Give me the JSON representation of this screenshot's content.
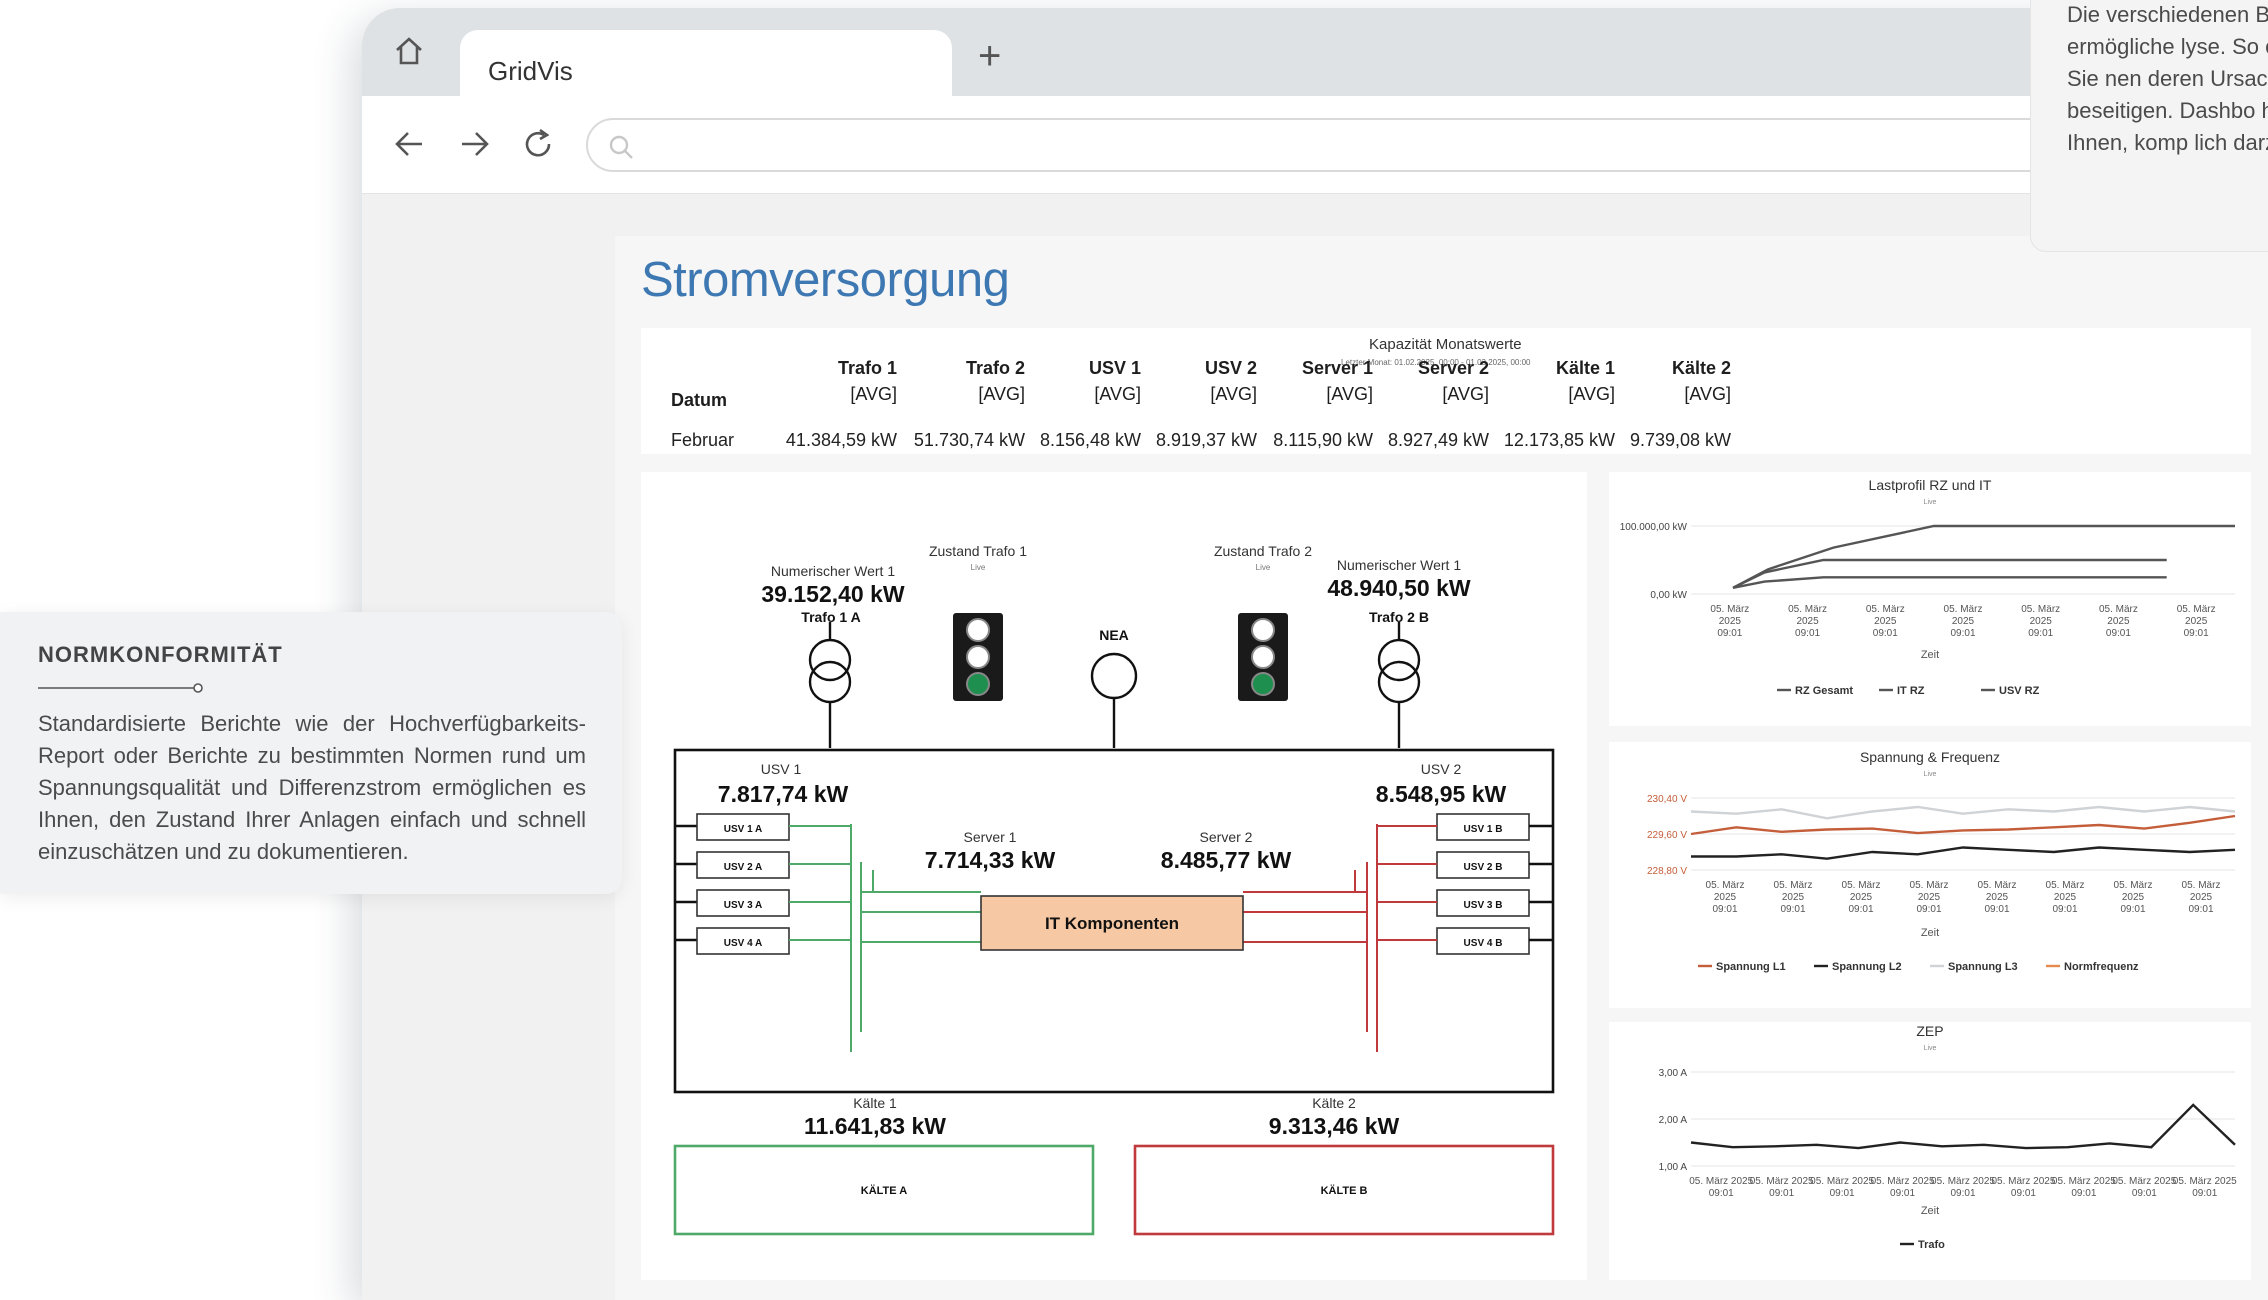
{
  "browser": {
    "tab_title": "GridVis",
    "new_tab_glyph": "+",
    "icons": [
      "home-icon",
      "back-icon",
      "forward-icon",
      "reload-icon",
      "search-icon"
    ]
  },
  "dashboard": {
    "title": "Stromversorgung",
    "table": {
      "title": "Kapazität Monatswerte",
      "subtitle": "Letzter Monat: 01.02.2025, 00:00 - 01.03.2025, 00:00",
      "date_header": "Datum",
      "avg_label": "[AVG]",
      "columns": [
        "Trafo 1",
        "Trafo 2",
        "USV 1",
        "USV 2",
        "Server 1",
        "Server 2",
        "Kälte 1",
        "Kälte 2"
      ],
      "row_label": "Februar",
      "values": [
        "41.384,59 kW",
        "51.730,74 kW",
        "8.156,48 kW",
        "8.919,37 kW",
        "8.115,90 kW",
        "8.927,49 kW",
        "12.173,85 kW",
        "9.739,08 kW"
      ]
    },
    "schematic": {
      "num_label": "Numerischer Wert 1",
      "trafo1_value": "39.152,40 kW",
      "trafo1_name": "Trafo 1 A",
      "trafo2_value": "48.940,50 kW",
      "trafo2_name": "Trafo 2 B",
      "state1_label": "Zustand Trafo 1",
      "state2_label": "Zustand Trafo 2",
      "live": "Live",
      "nea": "NEA",
      "usv1_label": "USV 1",
      "usv1_value": "7.817,74 kW",
      "usv2_label": "USV 2",
      "usv2_value": "8.548,95 kW",
      "server1_label": "Server 1",
      "server1_value": "7.714,33 kW",
      "server2_label": "Server 2",
      "server2_value": "8.485,77 kW",
      "it_label": "IT Komponenten",
      "usv_left": [
        "USV 1 A",
        "USV 2 A",
        "USV 3 A",
        "USV 4 A"
      ],
      "usv_right": [
        "USV 1 B",
        "USV 2 B",
        "USV 3 B",
        "USV 4 B"
      ],
      "kaelte1_label": "Kälte 1",
      "kaelte1_value": "11.641,83 kW",
      "kaelte2_label": "Kälte 2",
      "kaelte2_value": "9.313,46 kW",
      "kaelte_a": "KÄLTE A",
      "kaelte_b": "KÄLTE B",
      "colors": {
        "green": "#4faa6a",
        "red": "#c0393b",
        "orange": "#f6c9a4"
      }
    }
  },
  "chart_data": [
    {
      "type": "line",
      "title": "Lastprofil RZ und IT",
      "subtitle": "Live",
      "xlabel": "Zeit",
      "yticks": [
        "100.000,00 kW",
        "0,00 kW"
      ],
      "ylim": [
        -10000,
        100000
      ],
      "categories": [
        "05. März 2025 09:01",
        "05. März 2025 09:01",
        "05. März 2025 09:01",
        "05. März 2025 09:01",
        "05. März 2025 09:01",
        "05. März 2025 09:01",
        "05. März 2025 09:01"
      ],
      "x": [
        0,
        0.07,
        0.2,
        0.4,
        0.6,
        0.8,
        0.96,
        1
      ],
      "series": [
        {
          "name": "RZ Gesamt",
          "color": "#555555",
          "values": [
            0,
            30000,
            65000,
            100000,
            100000,
            100000,
            100000,
            100000
          ]
        },
        {
          "name": "IT RZ",
          "color": "#555555",
          "values": [
            0,
            25000,
            45000,
            45000,
            45000,
            45000,
            45000,
            null
          ]
        },
        {
          "name": "USV RZ",
          "color": "#555555",
          "values": [
            0,
            10000,
            17000,
            17000,
            17000,
            17000,
            17000,
            null
          ]
        }
      ]
    },
    {
      "type": "line",
      "title": "Spannung & Frequenz",
      "subtitle": "Live",
      "xlabel": "Zeit",
      "yticks": [
        "230,40 V",
        "229,60 V",
        "228,80 V"
      ],
      "ylim": [
        228.8,
        230.4
      ],
      "categories": [
        "05. März 2025 09:01",
        "05. März 2025 09:01",
        "05. März 2025 09:01",
        "05. März 2025 09:01",
        "05. März 2025 09:01",
        "05. März 2025 09:01",
        "05. März 2025 09:01",
        "05. März 2025 09:01"
      ],
      "series": [
        {
          "name": "Spannung L1",
          "color": "#c45e3a",
          "values": [
            229.6,
            229.75,
            229.65,
            229.7,
            229.72,
            229.62,
            229.68,
            229.7,
            229.75,
            229.8,
            229.72,
            229.85,
            230.0
          ]
        },
        {
          "name": "Spannung L2",
          "color": "#222222",
          "values": [
            229.1,
            229.1,
            229.15,
            229.05,
            229.2,
            229.15,
            229.3,
            229.25,
            229.2,
            229.3,
            229.25,
            229.2,
            229.25
          ]
        },
        {
          "name": "Spannung L3",
          "color": "#cfd3d6",
          "values": [
            230.1,
            230.05,
            230.15,
            229.95,
            230.1,
            230.2,
            230.05,
            230.15,
            230.1,
            230.2,
            230.1,
            230.2,
            230.1
          ]
        },
        {
          "name": "Normfrequenz",
          "color": "#e58a4e",
          "values": []
        }
      ]
    },
    {
      "type": "line",
      "title": "ZEP",
      "subtitle": "Live",
      "xlabel": "Zeit",
      "yticks": [
        "3,00 A",
        "2,00 A",
        "1,00 A"
      ],
      "ylim": [
        1,
        3
      ],
      "categories": [
        "05. März 2025 09:01",
        "05. März 2025 09:01",
        "05. März 2025 09:01",
        "05. März 2025 09:01",
        "05. März 2025 09:01",
        "05. März 2025 09:01",
        "05. März 2025 09:01",
        "05. März 2025 09:01",
        "05. März 2025 09:01"
      ],
      "series": [
        {
          "name": "Trafo",
          "color": "#222222",
          "values": [
            1.5,
            1.4,
            1.42,
            1.45,
            1.38,
            1.5,
            1.42,
            1.45,
            1.38,
            1.4,
            1.48,
            1.4,
            2.3,
            1.45
          ]
        }
      ]
    }
  ],
  "card_left": {
    "title": "NORMKONFORMITÄT",
    "text": "Standardisierte Berichte wie der Hochverfügbarkeits-Report oder Berichte zu bestimmten Normen rund um Spannungsqualität und Differenzstrom ermöglichen es Ihnen, den Zustand Ihrer Anlagen einfach und schnell einzuschätzen und zu dokumentieren."
  },
  "card_right": {
    "text": "Die verschiedenen Browser, ermögliche lyse. So erkennen Sie nen deren Ursacher beseitigen. Dashbo helfen Ihnen, komp lich darzustellen."
  }
}
